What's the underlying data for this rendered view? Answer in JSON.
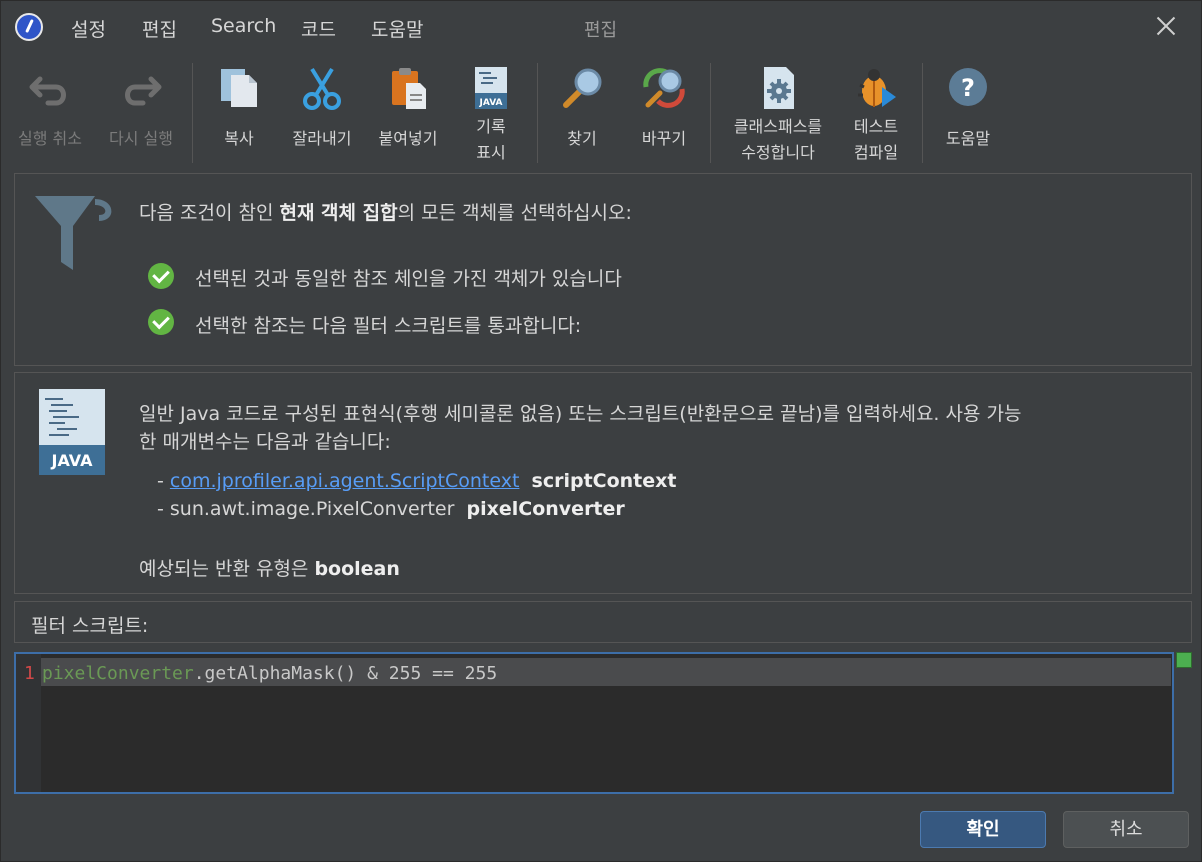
{
  "titlebar": {
    "menus": [
      "설정",
      "편집",
      "Search",
      "코드",
      "도움말"
    ],
    "title": "편집"
  },
  "toolbar": {
    "undo": "실행 취소",
    "redo": "다시 실행",
    "copy": "복사",
    "cut": "잘라내기",
    "paste": "붙여넣기",
    "show_history_l1": "기록",
    "show_history_l2": "표시",
    "find": "찾기",
    "replace": "바꾸기",
    "edit_classpath_l1": "클래스패스를",
    "edit_classpath_l2": "수정합니다",
    "test_compile_l1": "테스트",
    "test_compile_l2": "컴파일",
    "help": "도움말"
  },
  "filter_panel": {
    "intro_prefix": "다음 조건이 참인 ",
    "intro_bold": "현재 객체 집합",
    "intro_suffix": "의 모든 객체를 선택하십시오:",
    "cond1": "선택된 것과 동일한 참조 체인을 가진 객체가 있습니다",
    "cond2": "선택한 참조는 다음 필터 스크립트를 통과합니다:"
  },
  "script_panel": {
    "desc_line1": "일반 Java 코드로 구성된 표현식(후행 세미콜론 없음) 또는 스크립트(반환문으로 끝남)를 입력하세요. 사용 가능",
    "desc_line2": "한 매개변수는 다음과 같습니다:",
    "param1_type": "com.jprofiler.api.agent.ScriptContext",
    "param1_name": "scriptContext",
    "param2_type": "sun.awt.image.PixelConverter",
    "param2_name": "pixelConverter",
    "dash": "- ",
    "return_prefix": "예상되는 반환 유형은 ",
    "return_type": "boolean",
    "java_badge": "JAVA"
  },
  "script_label": "필터 스크립트:",
  "editor": {
    "line_number": "1",
    "code_var": "pixelConverter",
    "code_rest": ".getAlphaMask() & 255 == 255"
  },
  "buttons": {
    "ok": "확인",
    "cancel": "취소"
  },
  "colors": {
    "background": "#3c3f41",
    "accent": "#365880",
    "check": "#62b543",
    "link": "#589df6"
  }
}
